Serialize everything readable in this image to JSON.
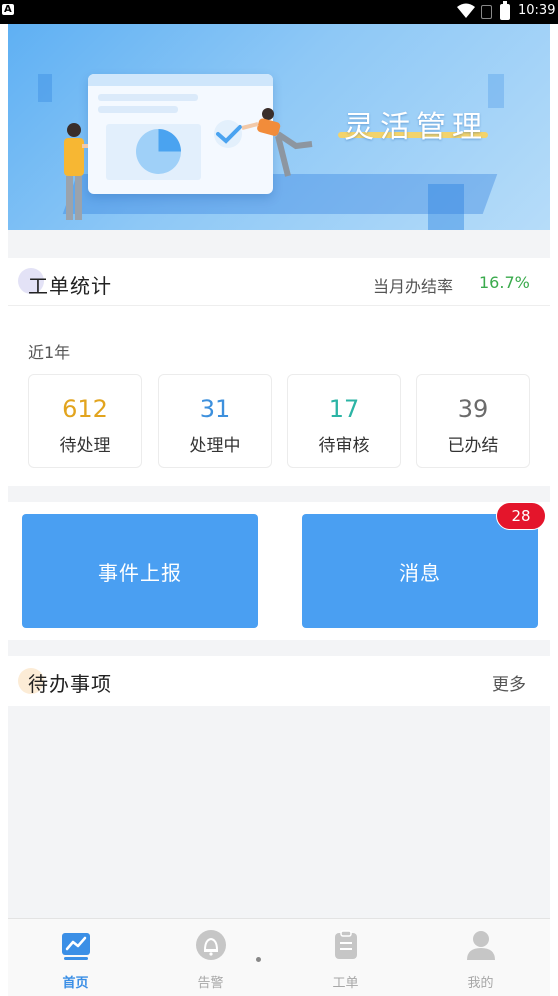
{
  "status_bar": {
    "indicator": "A",
    "time": "10:39",
    "icons": [
      "wifi-icon",
      "no-sim-icon",
      "battery-icon"
    ]
  },
  "banner": {
    "slogan": "灵活管理",
    "colors": {
      "sky": "#6fb7f4",
      "underline": "#f3d36b"
    }
  },
  "work_order_stats": {
    "title": "工单统计",
    "rate_label": "当月办结率",
    "rate_value": "16.7%",
    "period": "近1年",
    "items": [
      {
        "value": "612",
        "label": "待处理",
        "color": "#e2a41e"
      },
      {
        "value": "31",
        "label": "处理中",
        "color": "#3d90dd"
      },
      {
        "value": "17",
        "label": "待审核",
        "color": "#2cb4a5"
      },
      {
        "value": "39",
        "label": "已办结",
        "color": "#6b6b6b"
      }
    ]
  },
  "actions": {
    "report_label": "事件上报",
    "message_label": "消息",
    "message_badge": "28"
  },
  "todo": {
    "title": "待办事项",
    "more_label": "更多"
  },
  "tabbar": {
    "items": [
      {
        "label": "首页",
        "icon": "chart-icon",
        "active": true
      },
      {
        "label": "告警",
        "icon": "bell-icon",
        "active": false
      },
      {
        "label": "工单",
        "icon": "clipboard-icon",
        "active": false
      },
      {
        "label": "我的",
        "icon": "user-icon",
        "active": false
      }
    ]
  },
  "colors": {
    "accent": "#4a9ff2",
    "badge": "#e4152b",
    "rate": "#3aaa4c",
    "active_tab": "#3b8fe6",
    "inactive_tab": "#a7a7a7"
  }
}
